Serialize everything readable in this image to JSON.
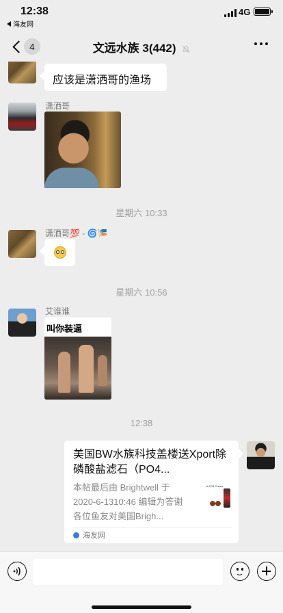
{
  "status": {
    "time": "12:38",
    "back_app": "海友网",
    "network": "4G"
  },
  "nav": {
    "unread_count": "4",
    "title": "文远水族 3(442)"
  },
  "messages": {
    "m1_text": "应该是潇洒哥的渔场",
    "m2_sender": "潇洒哥",
    "stamp1": "星期六 10:33",
    "m3_sender": "潇洒哥💯 - 🌀🎏",
    "stamp2": "星期六 10:56",
    "m4_sender": "艾谁谁",
    "m4_image_caption": "叫你装逼",
    "stamp3": "12:38"
  },
  "card": {
    "title": "美国BW水族科技盖楼送Xport除磷酸盐滤石（PO4...",
    "description": "本帖最后由 Brightwell 于 2020-6-1310:46 编辑为答谢各位鱼友对美国Brigh...",
    "thumb_text": "xt-PO4 Cubes",
    "source": "海友网"
  },
  "icons": {
    "back": "chevron-left-icon",
    "mute": "bell-slash-icon",
    "more": "more-dots-icon",
    "voice": "voice-icon",
    "emoji": "emoji-smile-icon",
    "add": "plus-circle-icon"
  }
}
